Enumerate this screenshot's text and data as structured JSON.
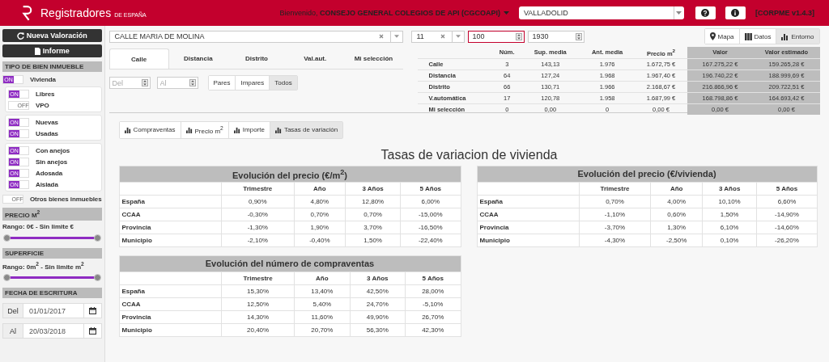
{
  "header": {
    "brand": "Registradores",
    "brand_suffix": "DE ESPAÑA",
    "welcome": "Bienvenido, **CONSEJO GENERAL COLEGIOS DE API (CGCOAPI)**",
    "region": "VALLADOLID",
    "version": "[CORPME v1.4.3]"
  },
  "sidebar": {
    "buttons": [
      {
        "label": "Nueva Valoración"
      },
      {
        "label": "Informe"
      }
    ],
    "blocks": [
      {
        "kind": "heading",
        "text": "TIPO DE BIEN INMUEBLE"
      },
      {
        "kind": "toggle",
        "label": "Vivienda",
        "on": true,
        "switch_text": "ON"
      },
      {
        "kind": "group",
        "items": [
          {
            "label": "Libres",
            "on": true,
            "switch_text": "ON"
          },
          {
            "label": "VPO",
            "on": false,
            "switch_text": "OFF"
          }
        ]
      },
      {
        "kind": "group",
        "items": [
          {
            "label": "Nuevas",
            "on": true,
            "switch_text": "ON"
          },
          {
            "label": "Usadas",
            "on": true,
            "switch_text": "ON"
          }
        ]
      },
      {
        "kind": "group",
        "items": [
          {
            "label": "Con anejos",
            "on": true,
            "switch_text": "ON"
          },
          {
            "label": "Sin anejos",
            "on": true,
            "switch_text": "ON"
          },
          {
            "label": "Adosada",
            "on": true,
            "switch_text": "ON"
          },
          {
            "label": "Aislada",
            "on": true,
            "switch_text": "ON"
          }
        ]
      },
      {
        "kind": "toggle",
        "label": "Otros bienes inmuebles",
        "on": false,
        "switch_text": "OFF"
      },
      {
        "kind": "heading",
        "text": "PRECIO M$^{2}$"
      },
      {
        "kind": "range",
        "text": "Rango: 0€ - Sin limite €",
        "level": 1
      },
      {
        "kind": "heading",
        "text": "SUPERFICIE"
      },
      {
        "kind": "range",
        "text": "Rango: 0m$^{2}$ - Sin limite m$^{2}$",
        "level": 1
      },
      {
        "kind": "heading",
        "text": "FECHA DE ESCRITURA"
      },
      {
        "kind": "date",
        "label": "Del",
        "value": "01/01/2017"
      },
      {
        "kind": "date",
        "label": "Al",
        "value": "20/03/2018"
      }
    ]
  },
  "search": {
    "street": "CALLE MARIA DE MOLINA",
    "number": "11",
    "fields": [
      {
        "value": "100",
        "focused": true
      },
      {
        "value": "1930",
        "focused": false
      }
    ]
  },
  "view_buttons": [
    {
      "label": "Mapa",
      "selected": false
    },
    {
      "label": "Datos",
      "selected": false
    },
    {
      "label": "Entorno",
      "selected": true
    }
  ],
  "filter_tabs": [
    {
      "label": "Calle",
      "selected": true
    },
    {
      "label": "Distancia",
      "selected": false
    },
    {
      "label": "Distrito",
      "selected": false
    },
    {
      "label": "Val.aut.",
      "selected": false
    },
    {
      "label": "Mi selección",
      "selected": false
    }
  ],
  "range_fields": [
    {
      "placeholder": "Del"
    },
    {
      "placeholder": "Al"
    }
  ],
  "parity_buttons": [
    {
      "label": "Pares",
      "selected": false
    },
    {
      "label": "Impares",
      "selected": false
    },
    {
      "label": "Todos",
      "selected": true
    }
  ],
  "summary": {
    "columns": [
      {
        "label": "Núm.",
        "shaded": false
      },
      {
        "label": "Sup. media",
        "shaded": false
      },
      {
        "label": "Ant. media",
        "shaded": false
      },
      {
        "label": "Precio m$^{2}$",
        "shaded": false
      },
      {
        "label": "Valor",
        "shaded": true
      },
      {
        "label": "Valor estimado",
        "shaded": true
      }
    ],
    "rows": [
      {
        "label": "Calle",
        "cells": [
          "3",
          "143,13",
          "1.976",
          "1.672,75 €",
          "167.275,22 €",
          "159.265,28 €"
        ]
      },
      {
        "label": "Distancia",
        "cells": [
          "64",
          "127,24",
          "1.968",
          "1.967,40 €",
          "196.740,22 €",
          "188.999,69 €"
        ]
      },
      {
        "label": "Distrito",
        "cells": [
          "66",
          "130,71",
          "1.966",
          "2.168,67 €",
          "216.866,96 €",
          "209.722,51 €"
        ]
      },
      {
        "label": "V.automática",
        "cells": [
          "17",
          "120,78",
          "1.958",
          "1.687,99 €",
          "168.798,86 €",
          "164.693,42 €"
        ]
      },
      {
        "label": "Mi selección",
        "cells": [
          "0",
          "0,00",
          "0",
          "0,00 €",
          "0,00 €",
          "0,00 €"
        ]
      }
    ]
  },
  "chart_tabs": [
    {
      "label": "Compraventas",
      "selected": false
    },
    {
      "label": "Precio m$^{2}$",
      "selected": false
    },
    {
      "label": "Importe",
      "selected": false
    },
    {
      "label": "Tasas de variación",
      "selected": true
    }
  ],
  "title": "Tasas de variacion de vivienda",
  "tables": [
    {
      "title": "Evolución del precio (€/m$^{2}$)",
      "columns": [
        "Trimestre",
        "Año",
        "3 Años",
        "5 Años"
      ],
      "rows": [
        {
          "label": "España",
          "cells": [
            "0,90%",
            "4,80%",
            "12,80%",
            "6,00%"
          ]
        },
        {
          "label": "CCAA",
          "cells": [
            "-0,30%",
            "0,70%",
            "0,70%",
            "-15,00%"
          ]
        },
        {
          "label": "Provincia",
          "cells": [
            "-1,30%",
            "1,90%",
            "3,70%",
            "-16,50%"
          ]
        },
        {
          "label": "Municipio",
          "cells": [
            "-2,10%",
            "-0,40%",
            "1,50%",
            "-22,40%"
          ]
        }
      ]
    },
    {
      "title": "Evolución del precio (€/vivienda)",
      "columns": [
        "Trimestre",
        "Año",
        "3 Años",
        "5 Años"
      ],
      "rows": [
        {
          "label": "España",
          "cells": [
            "0,70%",
            "4,00%",
            "10,10%",
            "6,60%"
          ]
        },
        {
          "label": "CCAA",
          "cells": [
            "-1,10%",
            "0,60%",
            "1,50%",
            "-14,90%"
          ]
        },
        {
          "label": "Provincia",
          "cells": [
            "-3,70%",
            "1,30%",
            "6,10%",
            "-14,60%"
          ]
        },
        {
          "label": "Municipio",
          "cells": [
            "-4,30%",
            "-2,50%",
            "0,10%",
            "-26,20%"
          ]
        }
      ]
    },
    {
      "title": "Evolución del número de compraventas",
      "columns": [
        "Trimestre",
        "Año",
        "3 Años",
        "5 Años"
      ],
      "rows": [
        {
          "label": "España",
          "cells": [
            "15,30%",
            "13,40%",
            "42,50%",
            "28,00%"
          ]
        },
        {
          "label": "CCAA",
          "cells": [
            "12,50%",
            "5,40%",
            "24,70%",
            "-5,10%"
          ]
        },
        {
          "label": "Provincia",
          "cells": [
            "14,30%",
            "11,60%",
            "49,90%",
            "26,70%"
          ]
        },
        {
          "label": "Municipio",
          "cells": [
            "20,40%",
            "20,70%",
            "56,30%",
            "42,30%"
          ]
        }
      ]
    }
  ]
}
